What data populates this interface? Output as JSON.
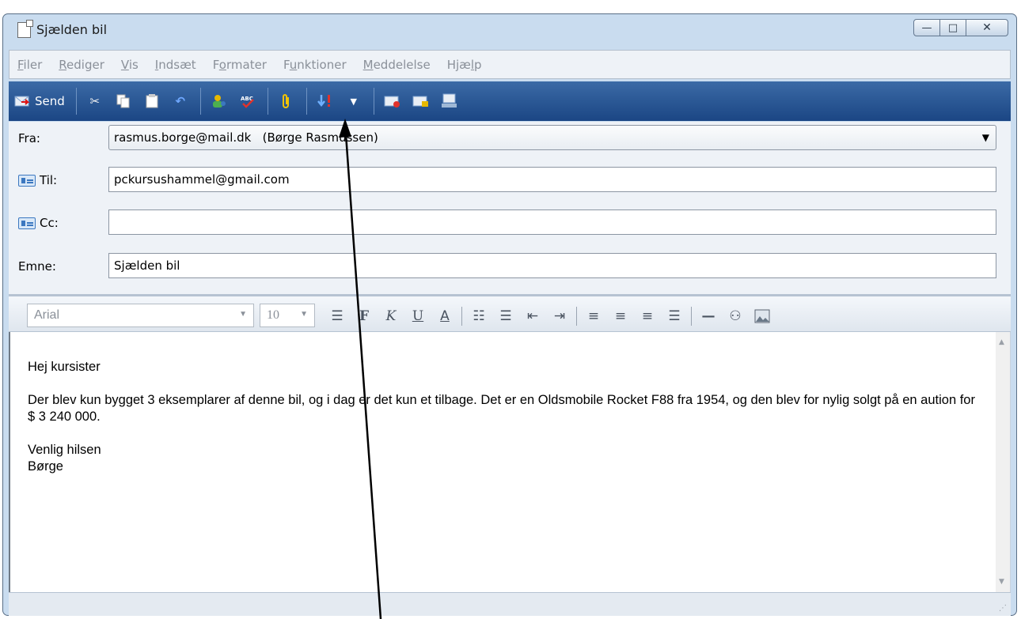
{
  "window": {
    "title": "Sjælden bil",
    "controls": {
      "minimize": "—",
      "maximize": "□",
      "close": "✕"
    }
  },
  "menu": {
    "items": [
      {
        "label": "Filer",
        "underline": "F",
        "rest": "iler"
      },
      {
        "label": "Rediger",
        "underline": "R",
        "rest": "ediger"
      },
      {
        "label": "Vis",
        "underline": "V",
        "rest": "is"
      },
      {
        "label": "Indsæt",
        "underline": "I",
        "rest": "ndsæt"
      },
      {
        "label": "Formater",
        "underline": "o",
        "pre": "F",
        "rest": "rmater"
      },
      {
        "label": "Funktioner",
        "underline": "u",
        "pre": "F",
        "rest": "nktioner"
      },
      {
        "label": "Meddelelse",
        "underline": "M",
        "rest": "eddelelse"
      },
      {
        "label": "Hjælp",
        "underline": "l",
        "pre": "Hjæ",
        "rest": "p"
      }
    ]
  },
  "toolbar": {
    "send_label": "Send",
    "icons": [
      "send-icon",
      "cut-icon",
      "copy-icon",
      "paste-icon",
      "undo-icon",
      "address-book-icon",
      "spellcheck-icon",
      "attach-icon",
      "priority-icon",
      "sign-icon",
      "encrypt-icon",
      "offline-icon"
    ]
  },
  "header": {
    "from_label": "Fra:",
    "from_value": "rasmus.borge@mail.dk   (Børge Rasmussen)",
    "to_label": "Til:",
    "to_value": "pckursushammel@gmail.com",
    "cc_label": "Cc:",
    "cc_value": "",
    "subject_label": "Emne:",
    "subject_value": "Sjælden bil"
  },
  "format": {
    "font": "Arial",
    "size": "10",
    "bold": "F",
    "italic": "K",
    "underline": "U",
    "color": "A"
  },
  "body": {
    "lines": [
      "Hej kursister",
      "Der blev kun bygget 3 eksemplarer af denne bil, og i dag er det kun et tilbage. Det er en Oldsmobile Rocket F88 fra 1954, og den blev for nylig solgt på en aution for $ 3 240 000.",
      "Venlig hilsen",
      "Børge"
    ]
  },
  "colors": {
    "toolbar": "#1b4684",
    "frame": "#c9dcef",
    "accent": "#e8b000"
  }
}
